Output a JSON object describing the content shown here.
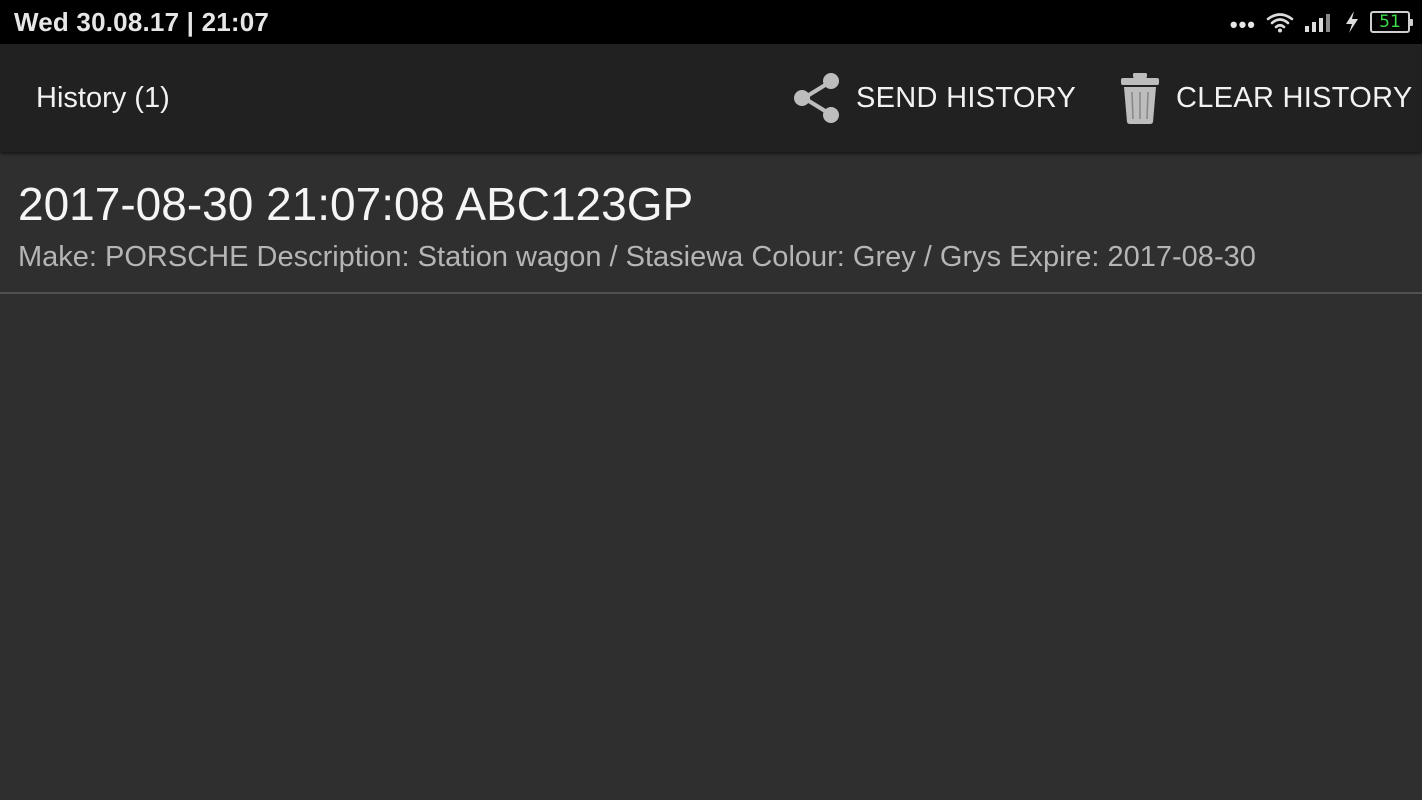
{
  "status_bar": {
    "datetime": "Wed 30.08.17 | 21:07",
    "more_dots": "•••",
    "battery_level": "51",
    "battery_color": "#3ddc4a"
  },
  "action_bar": {
    "title": "History (1)",
    "send_label": "SEND HISTORY",
    "send_icon": "share-icon",
    "clear_label": "CLEAR HISTORY",
    "clear_icon": "trash-icon"
  },
  "history": {
    "items": [
      {
        "title": "2017-08-30 21:07:08 ABC123GP",
        "details": "Make: PORSCHE Description: Station wagon / Stasiewa Colour: Grey / Grys Expire: 2017-08-30"
      }
    ]
  }
}
